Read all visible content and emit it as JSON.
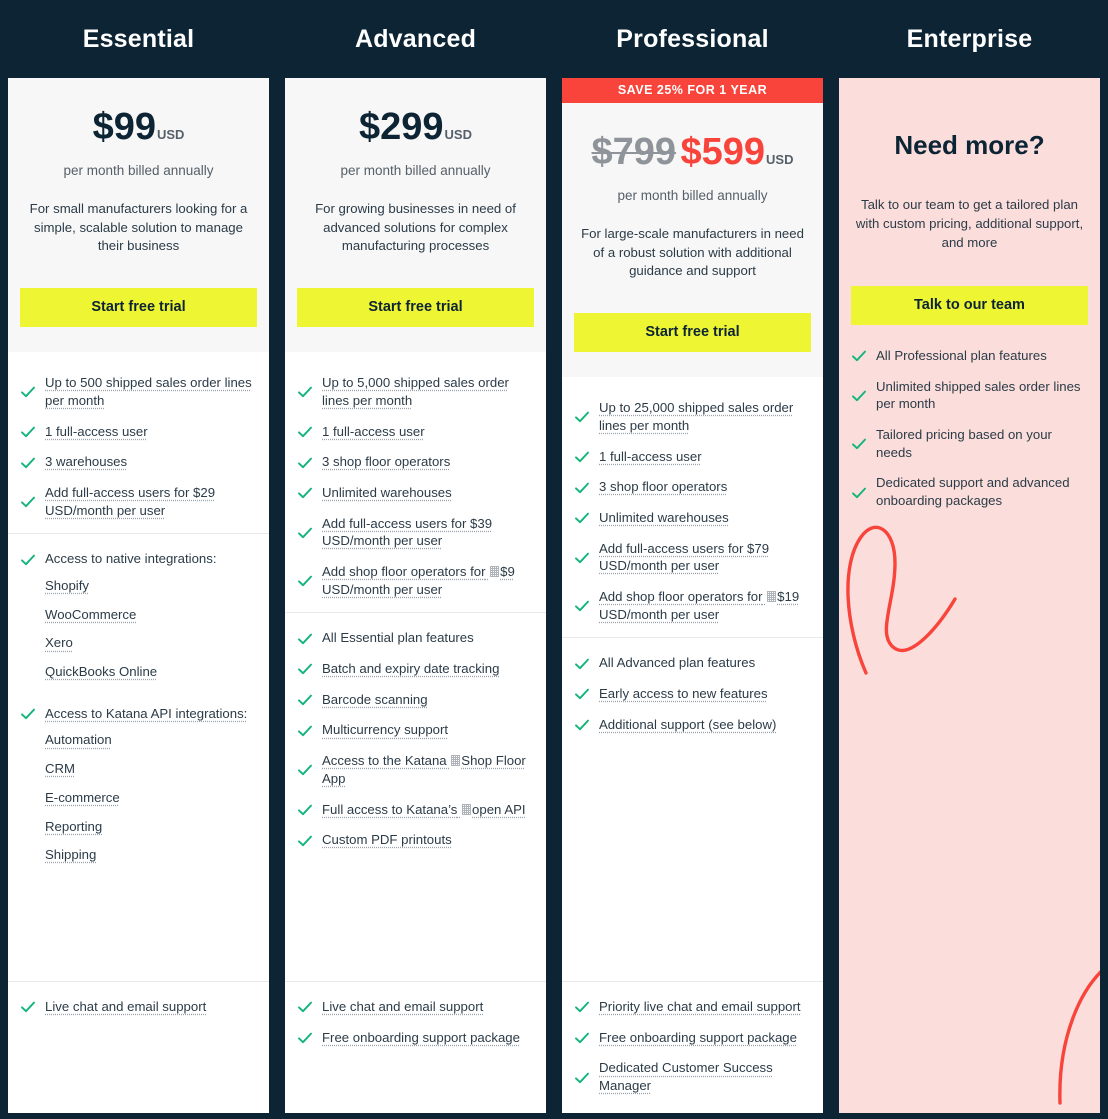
{
  "theme": {
    "dark": "#0d2435",
    "accent_yellow": "#eef532",
    "accent_red": "#f8443a",
    "check_green": "#13b47a",
    "pink_panel": "#fbdedc",
    "light_panel": "#f7f7f7"
  },
  "icons": {
    "check": "check-icon"
  },
  "plans": [
    {
      "id": "essential",
      "name": "Essential",
      "badge": null,
      "price": "$99",
      "price_old": null,
      "currency": "USD",
      "billing_note": "per month billed annually",
      "description": "For small manufacturers looking for a simple, scalable solution to manage their business",
      "cta_label": "Start free trial",
      "blocks": [
        {
          "items": [
            {
              "text": "Up to 500 shipped sales order lines per month",
              "link": true
            },
            {
              "text": "1 full-access user",
              "link": true
            },
            {
              "text": "3 warehouses",
              "link": true
            },
            {
              "text": "Add full-access users for $29 USD/month per user",
              "link": true
            }
          ]
        },
        {
          "items": [
            {
              "text": "Access to native integrations:",
              "link": false,
              "sub_items": [
                "Shopify",
                "WooCommerce",
                "Xero",
                "QuickBooks Online"
              ]
            },
            {
              "text": "Access to Katana API integrations:",
              "link": true,
              "sub_items": [
                "Automation",
                "CRM",
                "E-commerce",
                "Reporting",
                "Shipping"
              ]
            }
          ]
        },
        {
          "items": [
            {
              "text": "Live chat and email support",
              "link": true
            }
          ]
        }
      ]
    },
    {
      "id": "advanced",
      "name": "Advanced",
      "badge": null,
      "price": "$299",
      "price_old": null,
      "currency": "USD",
      "billing_note": "per month billed annually",
      "description": "For growing businesses in need of advanced solutions for complex manufacturing processes",
      "cta_label": "Start free trial",
      "blocks": [
        {
          "items": [
            {
              "text": "Up to 5,000 shipped sales order lines per month",
              "link": true
            },
            {
              "text": "1 full-access user",
              "link": true
            },
            {
              "text": "3 shop floor operators",
              "link": true
            },
            {
              "text": "Unlimited warehouses",
              "link": true
            },
            {
              "text": "Add full-access users for $39 USD/month per user",
              "link": true
            },
            {
              "text_before": "Add shop floor operators for",
              "glyph": true,
              "text_after": "$9 USD/month per user",
              "link": true
            }
          ]
        },
        {
          "items": [
            {
              "text": "All Essential plan features",
              "link": false
            },
            {
              "text": "Batch and expiry date tracking",
              "link": true
            },
            {
              "text": "Barcode scanning",
              "link": true
            },
            {
              "text": "Multicurrency support",
              "link": true
            },
            {
              "text_before": "Access to the Katana",
              "glyph": true,
              "text_after": "Shop Floor App",
              "link": true
            },
            {
              "text_before": "Full access to Katana’s",
              "glyph": true,
              "text_after": "open API",
              "link": true
            },
            {
              "text": "Custom PDF printouts",
              "link": true
            }
          ]
        },
        {
          "items": [
            {
              "text": "Live chat and email support",
              "link": true
            },
            {
              "text": "Free onboarding support package",
              "link": true
            }
          ]
        }
      ]
    },
    {
      "id": "professional",
      "name": "Professional",
      "badge": "SAVE 25% FOR 1 YEAR",
      "price": "$599",
      "price_old": "$799",
      "currency": "USD",
      "billing_note": "per month billed annually",
      "description": "For large-scale manufacturers in need of a robust solution with additional guidance and support",
      "cta_label": "Start free trial",
      "blocks": [
        {
          "items": [
            {
              "text": "Up to 25,000 shipped sales order lines per month",
              "link": true
            },
            {
              "text": "1 full-access user",
              "link": true
            },
            {
              "text": "3 shop floor operators",
              "link": true
            },
            {
              "text": "Unlimited warehouses",
              "link": true
            },
            {
              "text": "Add full-access users for $79 USD/month per user",
              "link": true
            },
            {
              "text_before": "Add shop floor operators for",
              "glyph": true,
              "text_after": "$19 USD/month per user",
              "link": true
            }
          ]
        },
        {
          "items": [
            {
              "text": "All Advanced plan features",
              "link": false
            },
            {
              "text": "Early access to new features",
              "link": true
            },
            {
              "text": "Additional support (see below)",
              "link": true
            }
          ]
        },
        {
          "items": [
            {
              "text": "Priority live chat and email support",
              "link": true
            },
            {
              "text": "Free onboarding support package",
              "link": true
            },
            {
              "text": "Dedicated Customer Success Manager",
              "link": true
            }
          ]
        }
      ]
    },
    {
      "id": "enterprise",
      "name": "Enterprise",
      "badge": null,
      "headline": "Need more?",
      "description": "Talk to our team to get a tailored plan with custom pricing, additional support, and more",
      "cta_label": "Talk to our team",
      "blocks": [
        {
          "items": [
            {
              "text": "All Professional plan features",
              "link": false
            },
            {
              "text": "Unlimited shipped sales order lines per month",
              "link": false
            },
            {
              "text": "Tailored pricing based on your needs",
              "link": false
            },
            {
              "text": "Dedicated support and advanced onboarding packages",
              "link": false
            }
          ]
        }
      ]
    }
  ]
}
